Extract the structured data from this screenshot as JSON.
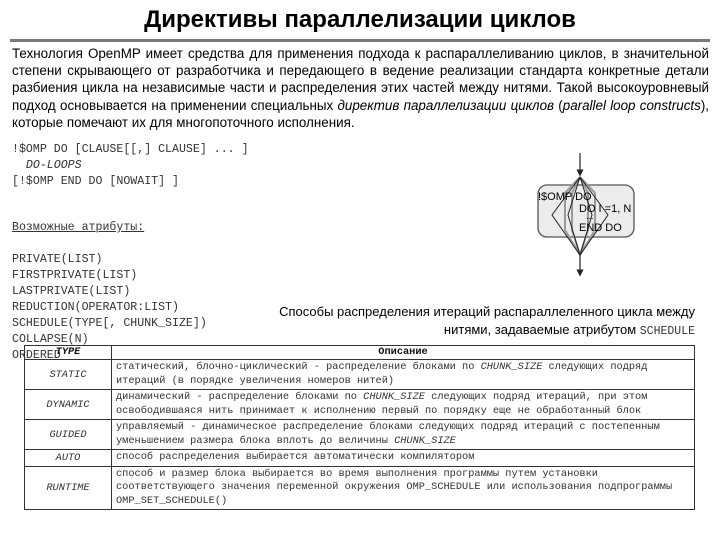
{
  "title": "Директивы параллелизации циклов",
  "intro": {
    "part1": "Технология OpenMP имеет средства для применения подхода к распараллеливанию циклов, в значительной степени скрывающего от разработчика и передающего в ведение реализации стандарта конкретные детали разбиения цикла на независимые части и распределения этих частей между нитями. Такой высокоуровневый подход основывается на применении специальных ",
    "italic1": "директив параллелизации циклов",
    "part2": " (",
    "italic2": "parallel loop constructs",
    "part3": "), которые помечают их для многопоточного исполнения."
  },
  "syntax": {
    "line1": "!$OMP DO [CLAUSE[[,] CLAUSE] ... ]",
    "line2": "  DO-LOOPS",
    "line3": "[!$OMP END DO [NOWAIT] ]"
  },
  "attributes": {
    "heading": "Возможные атрибуты:",
    "items": [
      "PRIVATE(LIST)",
      "FIRSTPRIVATE(LIST)",
      "LASTPRIVATE(LIST)",
      "REDUCTION(OPERATOR:LIST)",
      "SCHEDULE(TYPE[, CHUNK_SIZE])",
      "COLLAPSE(N)",
      "ORDERED"
    ]
  },
  "diagram": {
    "label_directive": "!$OMP DO",
    "label_loop": "DO I =1, N",
    "label_dots": "...",
    "label_end": "END DO"
  },
  "caption": {
    "text": "Способы распределения итераций распараллеленного цикла между нитями, задаваемые атрибутом ",
    "mono": "SCHEDULE"
  },
  "table": {
    "headers": [
      "TYPE",
      "Описание"
    ],
    "rows": [
      {
        "type": "STATIC",
        "desc": [
          "статический, блочно-циклический - распределение блоками по ",
          {
            "i": "CHUNK_SIZE"
          },
          " следующих подряд итераций (в порядке увеличения номеров нитей)"
        ]
      },
      {
        "type": "DYNAMIC",
        "desc": [
          "динамический - распределение блоками по ",
          {
            "i": "CHUNK_SIZE"
          },
          " следующих подряд итераций, при этом освободившаяся нить принимает к исполнению первый по порядку еще не обработанный блок"
        ]
      },
      {
        "type": "GUIDED",
        "desc": [
          "управляемый - динамическое распределение блоками следующих подряд итераций с постепенным уменьшением размера блока вплоть до величины ",
          {
            "i": "CHUNK_SIZE"
          }
        ]
      },
      {
        "type": "AUTO",
        "desc": [
          "способ распределения выбирается автоматически компилятором"
        ]
      },
      {
        "type": "RUNTIME",
        "desc": [
          "способ и размер блока выбирается во время выполнения программы путем установки соответствующего значения переменной окружения OMP_SCHEDULE или использования подпрограммы OMP_SET_SCHEDULE()"
        ]
      }
    ]
  }
}
